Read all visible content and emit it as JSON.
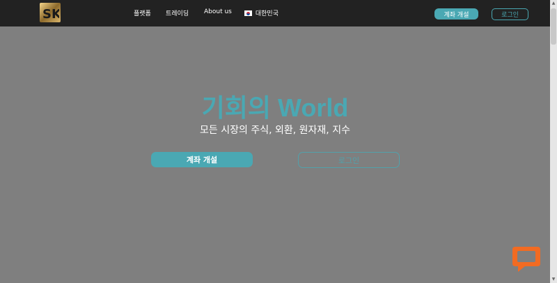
{
  "header": {
    "logo_text": "SK",
    "nav": [
      {
        "label": "플랫폼"
      },
      {
        "label": "트레이딩"
      },
      {
        "label": "About us"
      },
      {
        "label": "대한민국"
      }
    ],
    "open_account": "계좌 개설",
    "login": "로그인"
  },
  "hero": {
    "title": "기회의 World",
    "subtitle": "모든 시장의 주식, 외환, 원자재, 지수",
    "open_account": "계좌 개설",
    "login": "로그인"
  },
  "colors": {
    "accent": "#4aa8b3",
    "header_bg": "#222222",
    "overlay_bg": "#7f7f7f",
    "chat": "#f26b22"
  },
  "icons": [
    "sk-logo-icon",
    "korea-flag-icon",
    "chat-icon"
  ]
}
